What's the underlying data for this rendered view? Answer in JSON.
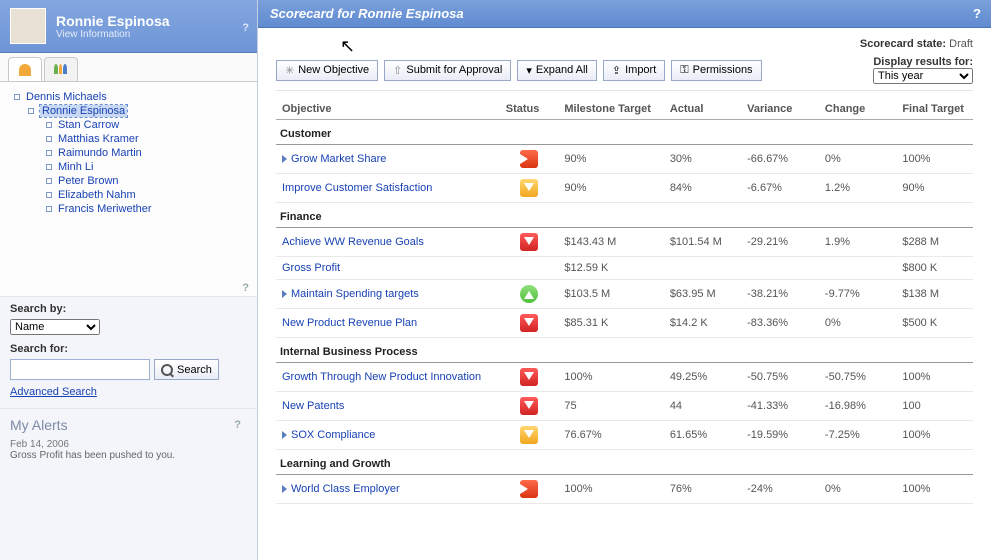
{
  "profile": {
    "name": "Ronnie Espinosa",
    "subtitle": "View Information"
  },
  "tree": {
    "root": "Dennis Michaels",
    "selected": "Ronnie Espinosa",
    "children": [
      "Stan Carrow",
      "Matthias Kramer",
      "Raimundo Martin",
      "Minh Li",
      "Peter Brown",
      "Elizabeth Nahm",
      "Francis Meriwether"
    ]
  },
  "search": {
    "by_label": "Search by:",
    "by_value": "Name",
    "for_label": "Search for:",
    "btn": "Search",
    "advanced": "Advanced Search"
  },
  "alerts": {
    "title": "My Alerts",
    "date": "Feb 14, 2006",
    "msg": "Gross Profit has been pushed to you."
  },
  "header": {
    "title": "Scorecard for Ronnie Espinosa"
  },
  "state": {
    "label": "Scorecard state:",
    "value": "Draft"
  },
  "display": {
    "label": "Display results for:",
    "value": "This year"
  },
  "toolbar": {
    "new": "New Objective",
    "submit": "Submit for Approval",
    "expand": "Expand All",
    "import": "Import",
    "perm": "Permissions"
  },
  "columns": {
    "objective": "Objective",
    "status": "Status",
    "milestone": "Milestone Target",
    "actual": "Actual",
    "variance": "Variance",
    "change": "Change",
    "final": "Final Target"
  },
  "sections": [
    {
      "name": "Customer",
      "rows": [
        {
          "name": "Grow Market Share",
          "expand": true,
          "status": "red-right",
          "milestone": "90%",
          "actual": "30%",
          "variance": "-66.67%",
          "change": "0%",
          "final": "100%"
        },
        {
          "name": "Improve Customer Satisfaction",
          "status": "yellow",
          "milestone": "90%",
          "actual": "84%",
          "variance": "-6.67%",
          "change": "1.2%",
          "final": "90%"
        }
      ]
    },
    {
      "name": "Finance",
      "rows": [
        {
          "name": "Achieve WW Revenue Goals",
          "status": "red-down",
          "milestone": "$143.43 M",
          "actual": "$101.54 M",
          "variance": "-29.21%",
          "change": "1.9%",
          "final": "$288 M"
        },
        {
          "name": "Gross Profit",
          "milestone": "$12.59 K",
          "actual": "",
          "variance": "",
          "change": "",
          "final": "$800 K"
        },
        {
          "name": "Maintain Spending targets",
          "expand": true,
          "status": "green",
          "milestone": "$103.5 M",
          "actual": "$63.95 M",
          "variance": "-38.21%",
          "change": "-9.77%",
          "final": "$138 M"
        },
        {
          "name": "New Product Revenue Plan",
          "status": "red-down",
          "milestone": "$85.31 K",
          "actual": "$14.2 K",
          "variance": "-83.36%",
          "change": "0%",
          "final": "$500 K"
        }
      ]
    },
    {
      "name": "Internal Business Process",
      "rows": [
        {
          "name": "Growth Through New Product Innovation",
          "status": "red-down",
          "milestone": "100%",
          "actual": "49.25%",
          "variance": "-50.75%",
          "change": "-50.75%",
          "final": "100%"
        },
        {
          "name": "New Patents",
          "status": "red-down",
          "milestone": "75",
          "actual": "44",
          "variance": "-41.33%",
          "change": "-16.98%",
          "final": "100"
        },
        {
          "name": "SOX Compliance",
          "expand": true,
          "status": "yellow",
          "milestone": "76.67%",
          "actual": "61.65%",
          "variance": "-19.59%",
          "change": "-7.25%",
          "final": "100%"
        }
      ]
    },
    {
      "name": "Learning and Growth",
      "rows": [
        {
          "name": "World Class Employer",
          "expand": true,
          "status": "red-right",
          "milestone": "100%",
          "actual": "76%",
          "variance": "-24%",
          "change": "0%",
          "final": "100%"
        }
      ]
    }
  ]
}
